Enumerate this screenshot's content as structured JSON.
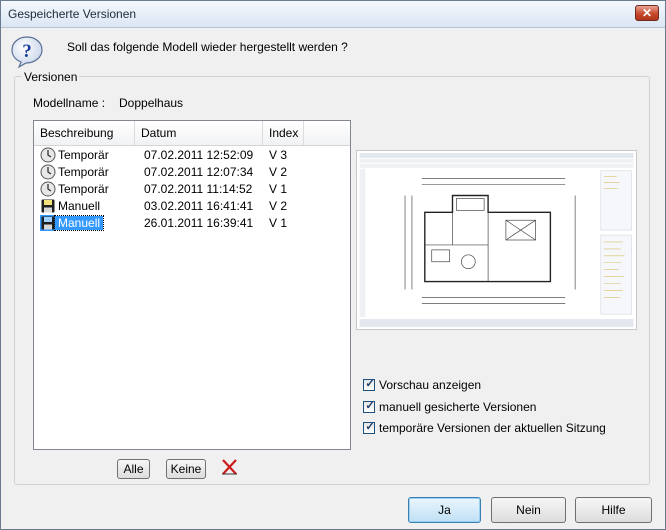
{
  "window": {
    "title": "Gespeicherte Versionen",
    "close_glyph": "✕"
  },
  "question": {
    "icon": "question-icon",
    "text": "Soll das folgende Modell wieder hergestellt werden ?"
  },
  "group": {
    "legend": "Versionen",
    "model_label": "Modellname :",
    "model_value": "Doppelhaus"
  },
  "list": {
    "columns": [
      "Beschreibung",
      "Datum",
      "Index"
    ],
    "rows": [
      {
        "icon": "clock-icon",
        "description": "Temporär",
        "date": "07.02.2011 12:52:09",
        "index": "V 3",
        "selected": false
      },
      {
        "icon": "clock-icon",
        "description": "Temporär",
        "date": "07.02.2011 12:07:34",
        "index": "V 2",
        "selected": false
      },
      {
        "icon": "clock-icon",
        "description": "Temporär",
        "date": "07.02.2011 11:14:52",
        "index": "V 1",
        "selected": false
      },
      {
        "icon": "floppy-disk-icon",
        "description": "Manuell",
        "date": "03.02.2011 16:41:41",
        "index": "V 2",
        "selected": false
      },
      {
        "icon": "floppy-disk-icon",
        "description": "Manuell",
        "date": "26.01.2011 16:39:41",
        "index": "V 1",
        "selected": true
      }
    ]
  },
  "list_buttons": {
    "all": "Alle",
    "none": "Keine",
    "delete_icon": "delete-x-icon",
    "delete_color": "#cc1b1b"
  },
  "checkboxes": [
    {
      "label": "Vorschau anzeigen",
      "checked": true
    },
    {
      "label": "manuell gesicherte Versionen",
      "checked": true
    },
    {
      "label": "temporäre Versionen der aktuellen Sitzung",
      "checked": true
    }
  ],
  "checkmark_glyph": "✓",
  "buttons": {
    "yes": "Ja",
    "no": "Nein",
    "help": "Hilfe"
  },
  "colors": {
    "selection": "#3399ff",
    "title_close": "#c8482c",
    "default_button_border": "#3c7fb1"
  }
}
